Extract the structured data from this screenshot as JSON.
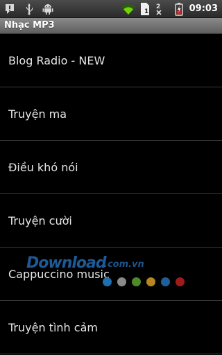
{
  "status_bar": {
    "time": "09:03",
    "icons": [
      "alert-icon",
      "usb-icon",
      "android-debug-icon",
      "wifi-icon",
      "sim-card-icon",
      "data-transfer-icon",
      "battery-icon"
    ],
    "sim_label": "1",
    "accent": "#6fd400"
  },
  "app": {
    "title": "Nhạc MP3"
  },
  "list": {
    "items": [
      {
        "label": "Blog Radio - NEW"
      },
      {
        "label": "Truyện ma"
      },
      {
        "label": "Điều khó nói"
      },
      {
        "label": "Truyện cười"
      },
      {
        "label": "Cappuccino music"
      },
      {
        "label": "Truyện tình cảm"
      }
    ]
  },
  "watermark": {
    "text": "Download",
    "suffix": ".com.vn",
    "dot_colors": [
      "#1f6fb0",
      "#8a8a8a",
      "#4f8a2a",
      "#b8861f",
      "#1f5f9a",
      "#a11a1a"
    ]
  }
}
